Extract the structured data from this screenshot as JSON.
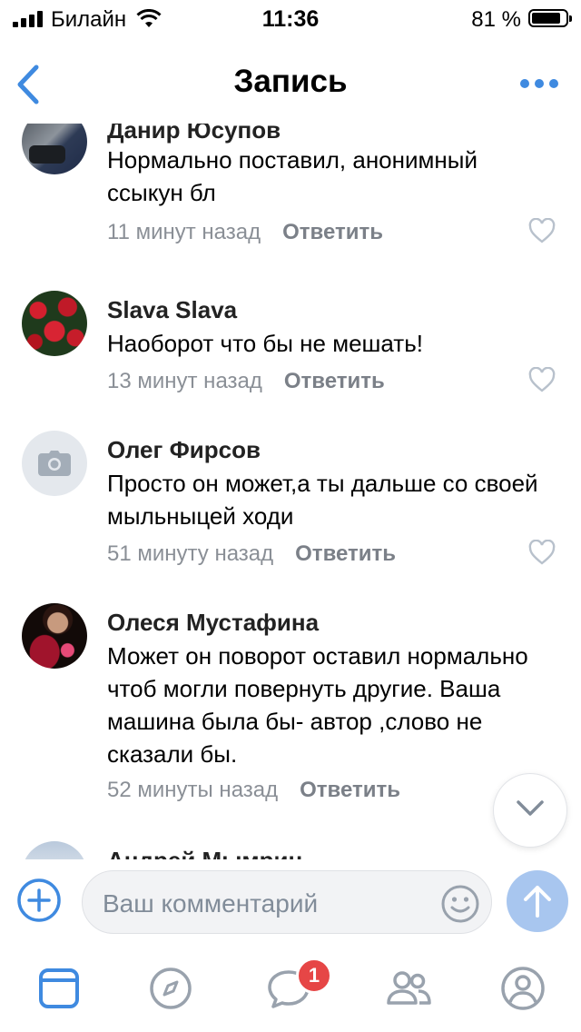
{
  "status_bar": {
    "carrier": "Билайн",
    "time": "11:36",
    "battery_percent": "81 %",
    "battery_level": 0.81
  },
  "nav": {
    "title": "Запись",
    "back_icon": "chevron-left-icon",
    "more_icon": "more-horizontal-icon"
  },
  "colors": {
    "accent": "#3f8ae0",
    "secondary_text": "#8a8f96",
    "like_icon": "#b8c1cc",
    "send_button": "#a8c6ef",
    "badge": "#e64646"
  },
  "comments": [
    {
      "author": "Данир Юсупов",
      "text": "Нормально поставил, анонимный ссыкун бл",
      "time": "11 минут назад",
      "reply": "Ответить"
    },
    {
      "author": "Slava Slava",
      "text": "Наоборот что бы не мешать!",
      "time": "13 минут назад",
      "reply": "Ответить"
    },
    {
      "author": "Олег Фирсов",
      "text": "Просто он может,а ты дальше  со своей мыльныцей ходи",
      "time": "51 минуту назад",
      "reply": "Ответить"
    },
    {
      "author": "Олеся Мустафина",
      "text": "Может он поворот оставил нормально чтоб могли повернуть другие. Ваша машина была бы- автор ,слово не сказали бы.",
      "time": "52 минуты назад",
      "reply": "Ответить"
    },
    {
      "author": "Андрей Мымрин"
    }
  ],
  "composer": {
    "placeholder": "Ваш комментарий"
  },
  "tabbar": {
    "tabs": [
      "newsfeed-icon",
      "explore-icon",
      "messages-icon",
      "friends-icon",
      "profile-icon"
    ],
    "messages_badge": "1"
  }
}
